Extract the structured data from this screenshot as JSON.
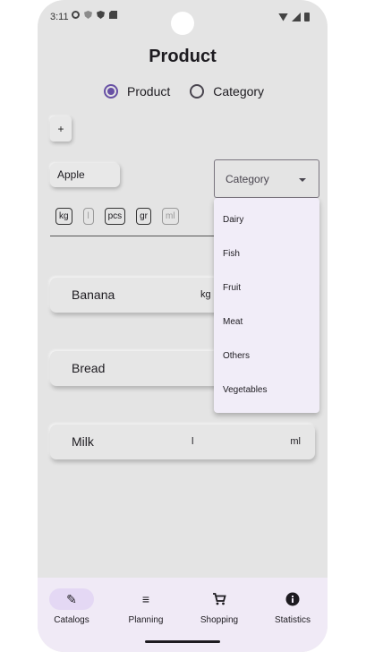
{
  "status_bar": {
    "time": "3:11"
  },
  "page": {
    "title": "Product"
  },
  "mode_radio": {
    "options": [
      {
        "label": "Product",
        "selected": true
      },
      {
        "label": "Category",
        "selected": false
      }
    ]
  },
  "form": {
    "add_label": "+",
    "name_value": "Apple",
    "category_label": "Category",
    "units": [
      {
        "label": "kg",
        "enabled": true
      },
      {
        "label": "l",
        "enabled": false
      },
      {
        "label": "pcs",
        "enabled": true
      },
      {
        "label": "gr",
        "enabled": true
      },
      {
        "label": "ml",
        "enabled": false
      }
    ]
  },
  "category_menu": {
    "items": [
      "Dairy",
      "Fish",
      "Fruit",
      "Meat",
      "Others",
      "Vegetables"
    ]
  },
  "products": [
    {
      "name": "Banana",
      "qty": "kg",
      "unit": ""
    },
    {
      "name": "Bread",
      "qty": "",
      "unit": ""
    },
    {
      "name": "Milk",
      "qty": "l",
      "unit": "ml"
    }
  ],
  "bottom_nav": {
    "items": [
      {
        "label": "Catalogs",
        "icon": "pencil-icon",
        "active": true
      },
      {
        "label": "Planning",
        "icon": "list-icon",
        "active": false
      },
      {
        "label": "Shopping",
        "icon": "cart-icon",
        "active": false
      },
      {
        "label": "Statistics",
        "icon": "info-icon",
        "active": false
      }
    ]
  },
  "colors": {
    "accent": "#6750a4",
    "nav_background": "#f0eaf6",
    "menu_background": "#f1edf8"
  }
}
